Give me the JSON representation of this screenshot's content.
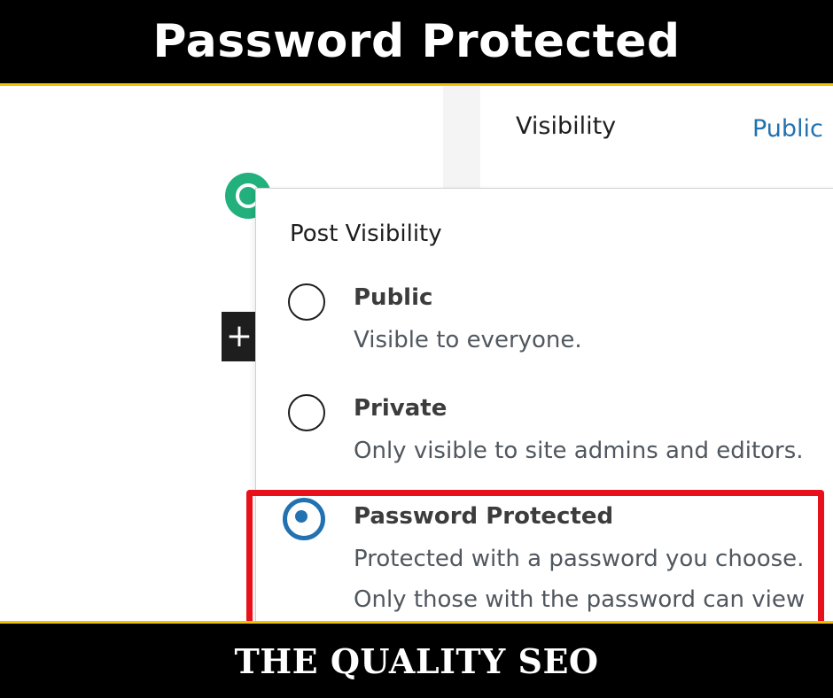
{
  "banner": {
    "title": "Password Protected"
  },
  "sidebar": {
    "visibility_label": "Visibility",
    "visibility_value": "Public"
  },
  "editor": {
    "add_block_symbol": "+"
  },
  "popover": {
    "title": "Post Visibility",
    "options": [
      {
        "label": "Public",
        "description": "Visible to everyone.",
        "checked": false
      },
      {
        "label": "Private",
        "description": "Only visible to site admins and editors.",
        "checked": false
      },
      {
        "label": "Password Protected",
        "description": "Protected with a password you choose.",
        "description_line2": "Only those with the password can view",
        "checked": true
      }
    ]
  },
  "footer": {
    "brand": "THE QUALITY SEO"
  },
  "colors": {
    "accent": "#2271b1",
    "highlight": "#e8101a",
    "banner_bg": "#000000",
    "banner_border": "#f2c200",
    "logo_green": "#22b07d"
  }
}
